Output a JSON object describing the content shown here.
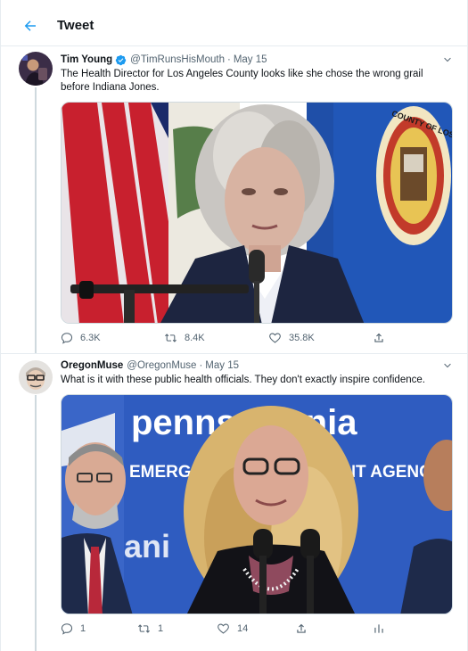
{
  "header": {
    "title": "Tweet"
  },
  "tweets": [
    {
      "name": "Tim Young",
      "handle": "@TimRunsHisMouth",
      "date": "May 15",
      "text": "The Health Director for Los Angeles County looks like she chose the wrong grail before Indiana Jones.",
      "verified": true,
      "actions": {
        "replies": "6.3K",
        "retweets": "8.4K",
        "likes": "35.8K"
      }
    },
    {
      "name": "OregonMuse",
      "handle": "@OregonMuse",
      "date": "May 15",
      "text": "What is it with these public health officials. They don't exactly inspire confidence.",
      "verified": false,
      "actions": {
        "replies": "1",
        "retweets": "1",
        "likes": "14"
      }
    }
  ],
  "media": {
    "seal_text": "COUNTY OF LOS ANGELES CALIFORNIA",
    "banner_title": "pennsylvania",
    "banner_subtitle": "EMERGENCY MANAGEMENT AGENCY"
  },
  "colors": {
    "accent": "#1d9bf0",
    "muted": "#536471",
    "border": "#e6ecf0"
  }
}
